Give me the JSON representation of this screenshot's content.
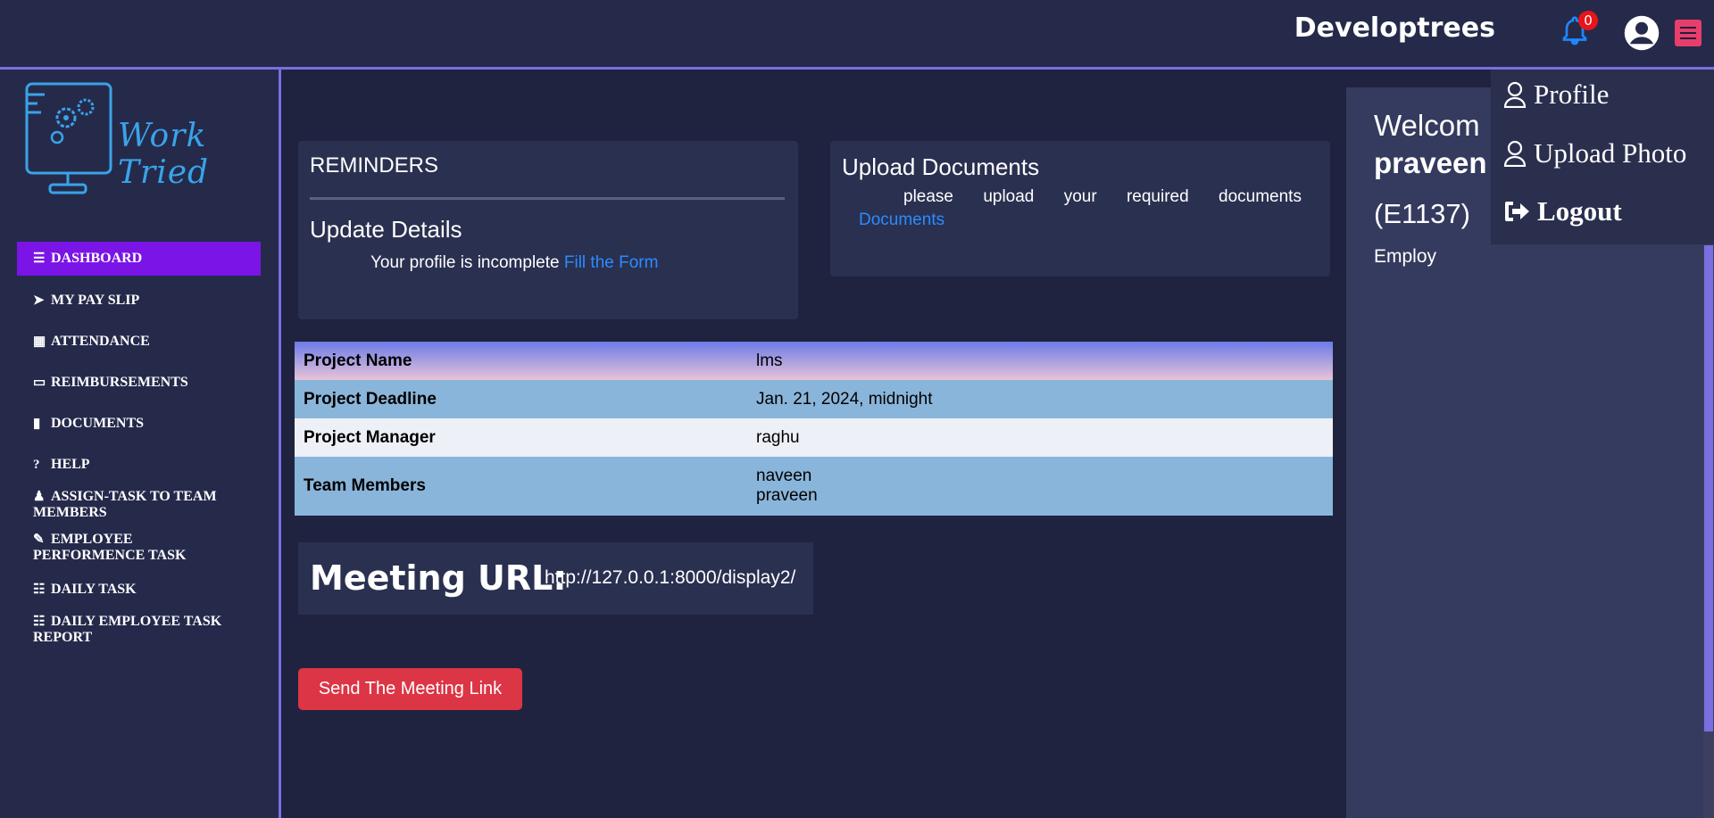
{
  "header": {
    "brand": "Developtrees",
    "notification_count": "0"
  },
  "sidebar": {
    "logo_text": "Work Tried",
    "items": [
      {
        "label": "DASHBOARD",
        "icon": "bars-icon",
        "active": true
      },
      {
        "label": "MY PAY SLIP",
        "icon": "paper-plane-icon"
      },
      {
        "label": "ATTENDANCE",
        "icon": "calendar-icon"
      },
      {
        "label": "REIMBURSEMENTS",
        "icon": "credit-card-icon"
      },
      {
        "label": "DOCUMENTS",
        "icon": "file-icon"
      },
      {
        "label": "HELP",
        "icon": "question-circle-icon"
      },
      {
        "label": "ASSIGN-TASK TO TEAM MEMBERS",
        "icon": "users-icon"
      },
      {
        "label": "EMPLOYEE PERFORMENCE TASK",
        "icon": "user-edit-icon"
      },
      {
        "label": "DAILY TASK",
        "icon": "list-check-icon"
      },
      {
        "label": "DAILY EMPLOYEE TASK REPORT",
        "icon": "list-check-icon"
      }
    ]
  },
  "reminders": {
    "title": "REMINDERS",
    "subtitle": "Update Details",
    "message": "Your profile is incomplete",
    "link": "Fill the Form"
  },
  "upload": {
    "title": "Upload Documents",
    "words": [
      "please",
      "upload",
      "your",
      "required",
      "documents"
    ],
    "link": "Documents"
  },
  "project": {
    "rows": [
      {
        "key": "Project Name",
        "value": "lms"
      },
      {
        "key": "Project Deadline",
        "value": "Jan. 21, 2024, midnight"
      },
      {
        "key": "Project Manager",
        "value": "raghu"
      },
      {
        "key": "Team Members",
        "value": "naveen",
        "value2": "praveen"
      }
    ]
  },
  "meeting": {
    "label": "Meeting URL:",
    "url": "http://127.0.0.1:8000/display2/",
    "send_button": "Send The Meeting Link"
  },
  "welcome": {
    "greeting": "Welcom",
    "name": "praveen",
    "emp_id": "(E1137)",
    "role": "Employ"
  },
  "dropdown": {
    "profile": "Profile",
    "upload_photo": "Upload Photo",
    "logout": "Logout"
  },
  "colors": {
    "accent": "#7b14e6",
    "link": "#2a8cff",
    "danger": "#dc3545",
    "bell": "#1e88ff",
    "menu": "#e83e6c"
  }
}
